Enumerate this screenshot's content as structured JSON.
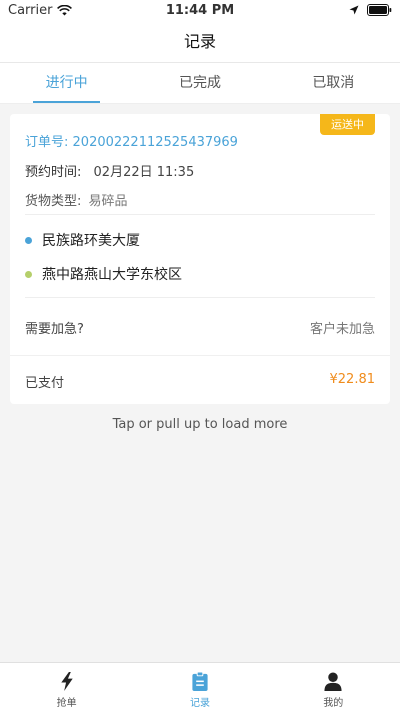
{
  "status_bar": {
    "carrier": "Carrier",
    "time": "11:44 PM"
  },
  "nav": {
    "title": "记录"
  },
  "tabs": [
    {
      "label": "进行中",
      "active": true
    },
    {
      "label": "已完成",
      "active": false
    },
    {
      "label": "已取消",
      "active": false
    }
  ],
  "order": {
    "badge": "运送中",
    "order_label": "订单号:",
    "order_no": "20200222112525437969",
    "time_label": "预约时间:",
    "time_value": "02月22日 11:35",
    "type_label": "货物类型:",
    "type_value": "易碎品",
    "from": "民族路环美大厦",
    "to": "燕中路燕山大学东校区",
    "urgent_label": "需要加急?",
    "urgent_value": "客户未加急",
    "pay_label": "已支付",
    "pay_amount": "¥22.81"
  },
  "load_more": "Tap or pull up to load more",
  "tab_bar": [
    {
      "label": "抢单",
      "icon": "lightning-icon",
      "active": false
    },
    {
      "label": "记录",
      "icon": "clipboard-icon",
      "active": true
    },
    {
      "label": "我的",
      "icon": "person-icon",
      "active": false
    }
  ],
  "colors": {
    "accent": "#4aa3d8",
    "badge": "#f5b71a",
    "price": "#f08c1c",
    "dot_from": "#4aa3d8",
    "dot_to": "#b5cf6b"
  }
}
